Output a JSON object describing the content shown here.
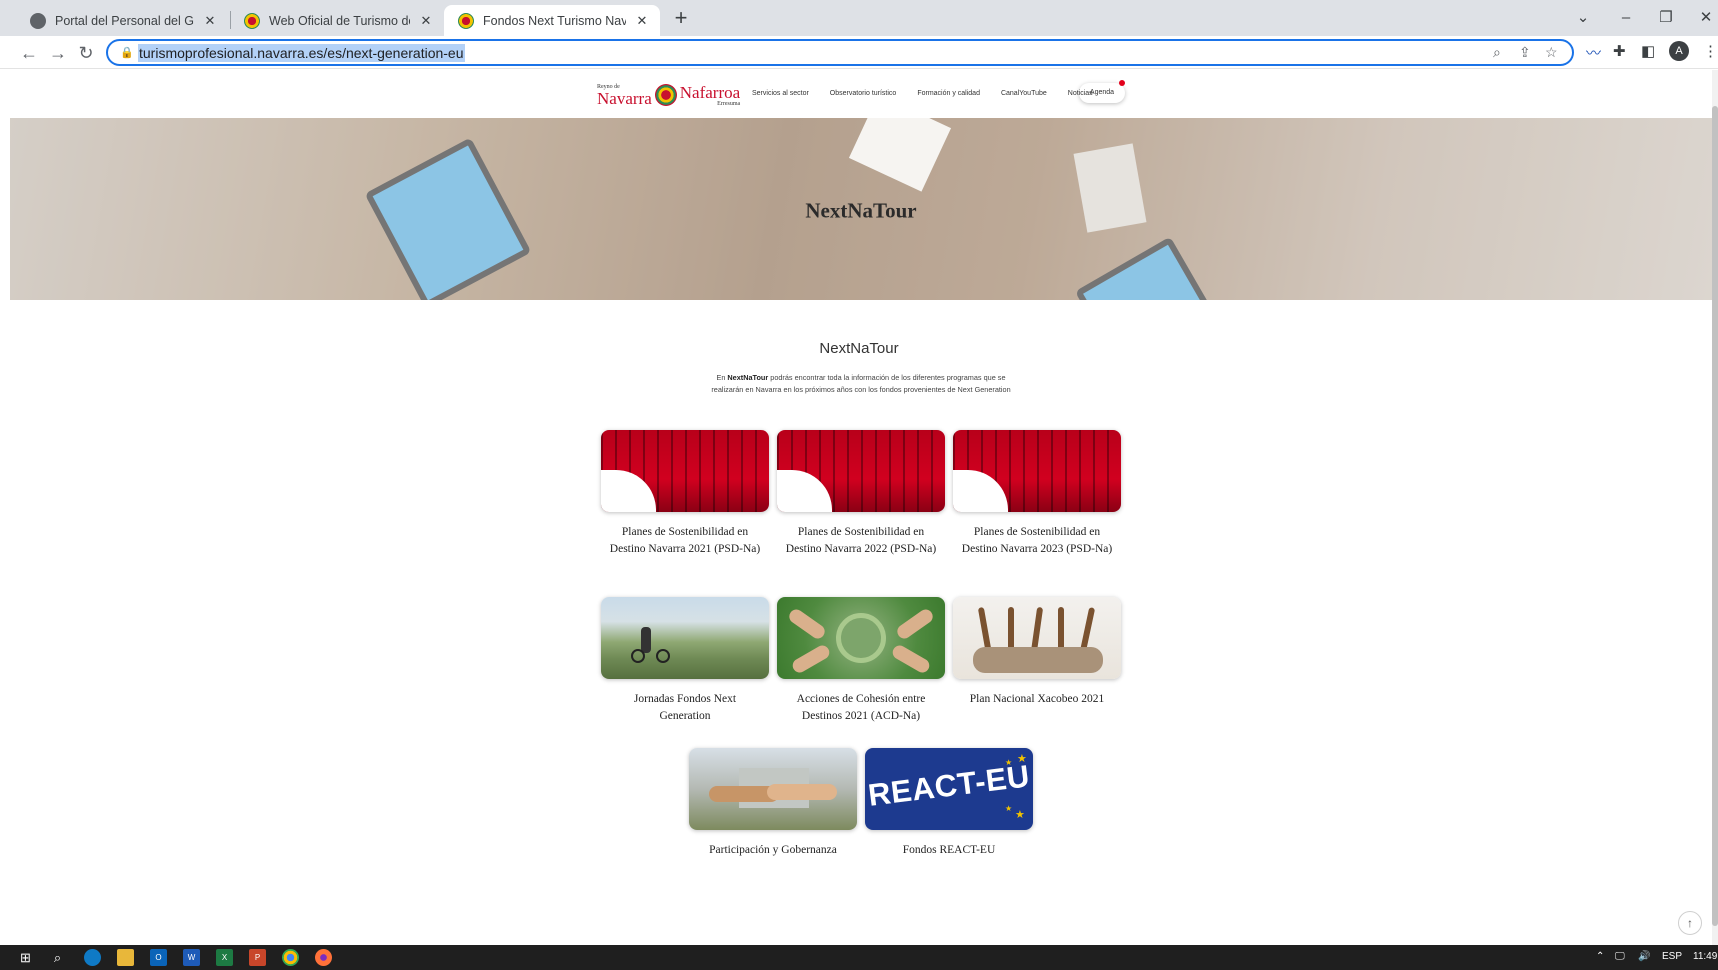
{
  "browser": {
    "tabs": [
      {
        "title": "Portal del Personal del Gobierno",
        "active": false
      },
      {
        "title": "Web Oficial de Turismo de Navarra",
        "active": false
      },
      {
        "title": "Fondos Next Turismo Navarra | W",
        "active": true
      }
    ],
    "url": "turismoprofesional.navarra.es/es/next-generation-eu",
    "profile_initial": "A"
  },
  "site": {
    "logo": {
      "text_left": "Navarra",
      "text_left_small": "Reyno de",
      "text_right": "Nafarroa",
      "text_right_small": "Erresuma"
    },
    "nav": [
      "Servicios al sector",
      "Observatorio turístico",
      "Formación y calidad",
      "CanalYouTube",
      "Noticias"
    ],
    "agenda_label": "Agenda",
    "hero_title": "NextNaTour",
    "section_title": "NextNaTour",
    "intro_prefix": "En ",
    "intro_bold": "NextNaTour",
    "intro_rest": " podrás encontrar toda la información de los diferentes programas que se realizarán en Navarra en los próximos años con los fondos provenientes de Next Generation",
    "cards": [
      {
        "title": "Planes de Sostenibilidad en Destino Navarra 2021 (PSD-Na)",
        "image": "red-arches"
      },
      {
        "title": "Planes de Sostenibilidad en Destino Navarra 2022 (PSD-Na)",
        "image": "red-arches"
      },
      {
        "title": "Planes de Sostenibilidad en Destino Navarra 2023 (PSD-Na)",
        "image": "red-arches"
      },
      {
        "title": "Jornadas Fondos Next Generation",
        "image": "cyclist-landscape"
      },
      {
        "title": "Acciones de Cohesión entre Destinos 2021 (ACD-Na)",
        "image": "hands-grass"
      },
      {
        "title": "Plan Nacional Xacobeo 2021",
        "image": "pilgrim-staffs"
      },
      {
        "title": "Participación y Gobernanza",
        "image": "handshake"
      },
      {
        "title": "Fondos REACT-EU",
        "image": "react-eu-banner",
        "image_text": "REACT-EU"
      }
    ]
  },
  "taskbar": {
    "language": "ESP",
    "time": "11:49"
  },
  "colors": {
    "accent": "#1a73e8",
    "brand_red": "#c8102e",
    "react_blue": "#1d3a8f"
  }
}
